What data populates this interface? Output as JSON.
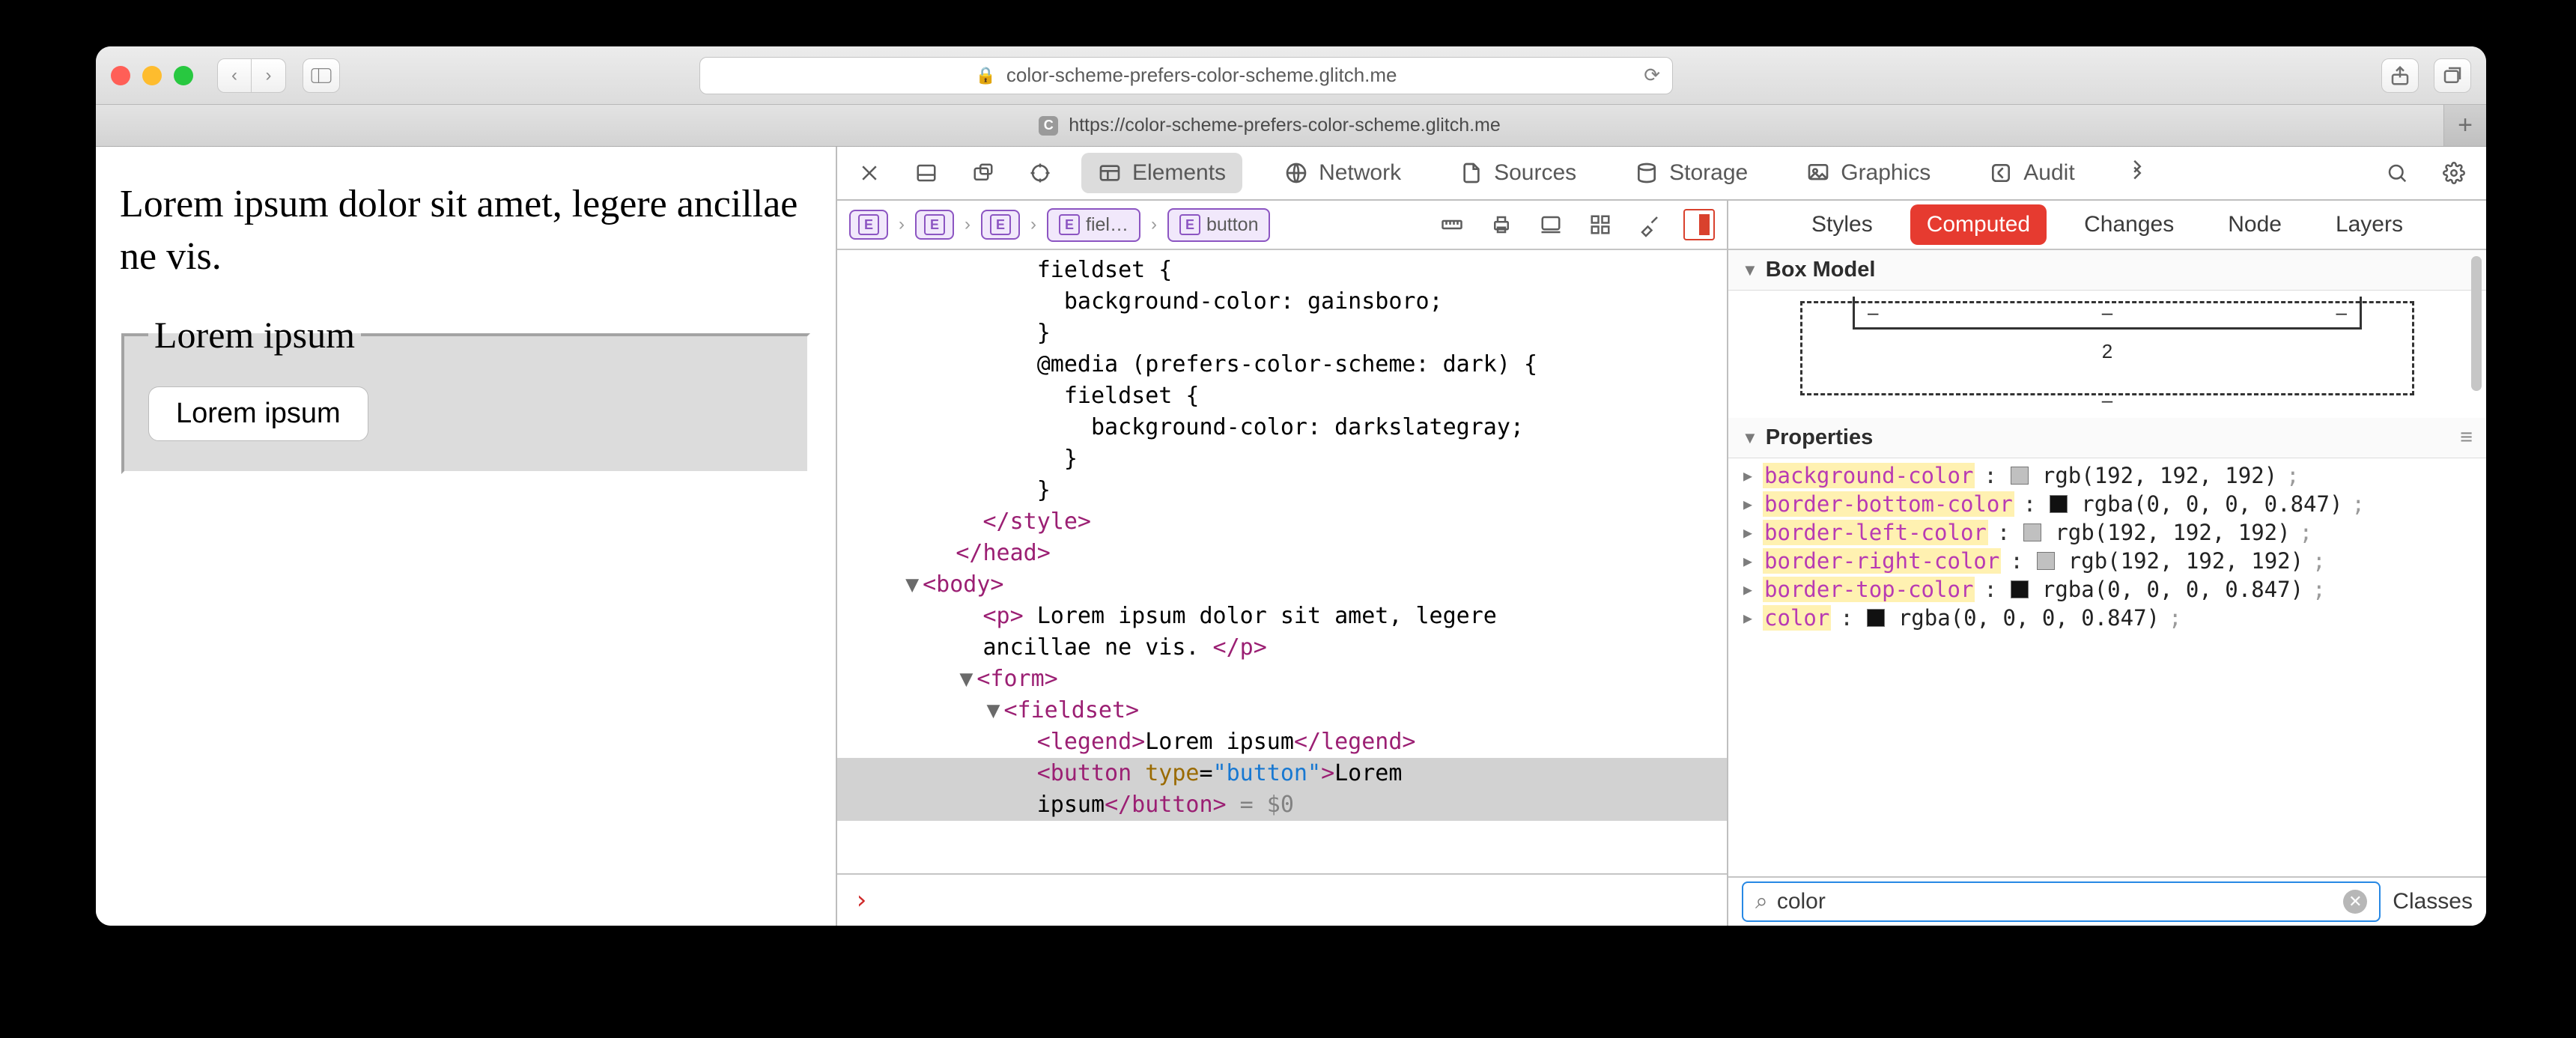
{
  "chrome": {
    "url": "color-scheme-prefers-color-scheme.glitch.me",
    "tab_url": "https://color-scheme-prefers-color-scheme.glitch.me",
    "tab_letter": "C"
  },
  "page": {
    "paragraph": "Lorem ipsum dolor sit amet, legere ancillae ne vis.",
    "legend": "Lorem ipsum",
    "button": "Lorem ipsum"
  },
  "devtools": {
    "tabs": {
      "elements": "Elements",
      "network": "Network",
      "sources": "Sources",
      "storage": "Storage",
      "graphics": "Graphics",
      "audit": "Audit"
    },
    "breadcrumbs": {
      "fieldset": "fiel…",
      "button": "button"
    },
    "source": {
      "l1": "fieldset {",
      "l2": "background-color: gainsboro;",
      "l3": "}",
      "l4": "@media (prefers-color-scheme: dark) {",
      "l5": "fieldset {",
      "l6": "background-color: darkslategray;",
      "l7": "}",
      "l8": "}",
      "l9": "</style>",
      "l10": "</head>",
      "l11": "<body>",
      "l12a": "<p>",
      "l12b": " Lorem ipsum dolor sit amet, legere",
      "l13a": "ancillae ne vis. ",
      "l13b": "</p>",
      "l14": "<form>",
      "l15": "<fieldset>",
      "l16a": "<legend>",
      "l16b": "Lorem ipsum",
      "l16c": "</legend>",
      "l17a": "<button",
      "l17b": "type",
      "l17c": "\"button\"",
      "l17d": ">",
      "l17e": "Lorem",
      "l18a": "ipsum",
      "l18b": "</button>",
      "l18c": " = $0"
    },
    "styles_tabs": {
      "styles": "Styles",
      "computed": "Computed",
      "changes": "Changes",
      "node": "Node",
      "layers": "Layers"
    },
    "boxmodel": {
      "title": "Box Model",
      "value": "2"
    },
    "properties_title": "Properties",
    "properties": [
      {
        "name": "background-color",
        "swatch": "#c0c0c0",
        "value": "rgb(192, 192, 192)"
      },
      {
        "name": "border-bottom-color",
        "swatch": "#111111",
        "value": "rgba(0, 0, 0, 0.847)"
      },
      {
        "name": "border-left-color",
        "swatch": "#c0c0c0",
        "value": "rgb(192, 192, 192)"
      },
      {
        "name": "border-right-color",
        "swatch": "#c0c0c0",
        "value": "rgb(192, 192, 192)"
      },
      {
        "name": "border-top-color",
        "swatch": "#111111",
        "value": "rgba(0, 0, 0, 0.847)"
      },
      {
        "name": "color",
        "swatch": "#111111",
        "value": "rgba(0, 0, 0, 0.847)"
      }
    ],
    "filter": {
      "value": "color",
      "classes": "Classes"
    },
    "console_prompt": "›"
  }
}
